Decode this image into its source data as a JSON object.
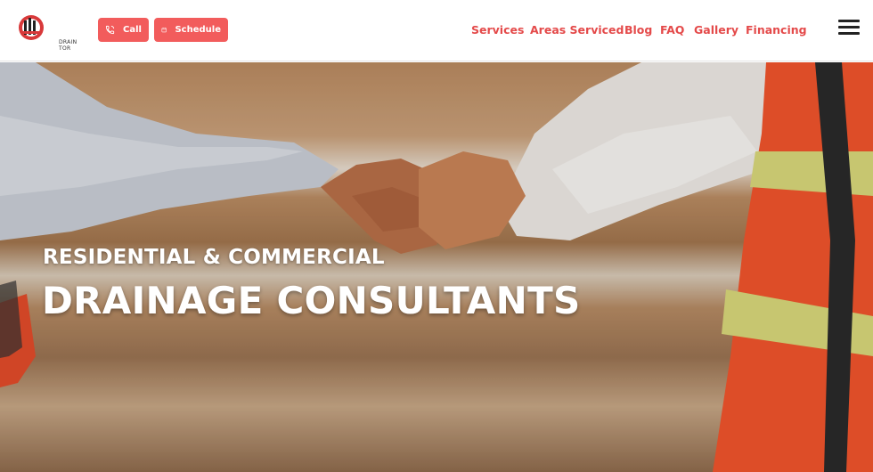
{
  "header": {
    "logo_text_line1": "DRAIN",
    "logo_text_line2": "TOR",
    "call_label": "Call",
    "schedule_label": "Schedule",
    "nav": [
      {
        "label": "Services"
      },
      {
        "label": "Areas Serviced"
      },
      {
        "label": "Blog"
      },
      {
        "label": "FAQ"
      },
      {
        "label": "Gallery"
      },
      {
        "label": "Financing"
      }
    ],
    "menu_icon": "hamburger-menu-icon"
  },
  "hero": {
    "subtitle": "RESIDENTIAL & COMMERCIAL",
    "title": "DRAINAGE CONSULTANTS"
  },
  "colors": {
    "accent": "#f25c5c",
    "nav_text": "#e44a4a",
    "vest_orange": "#f0542c",
    "vest_reflective": "#d8d77a"
  }
}
